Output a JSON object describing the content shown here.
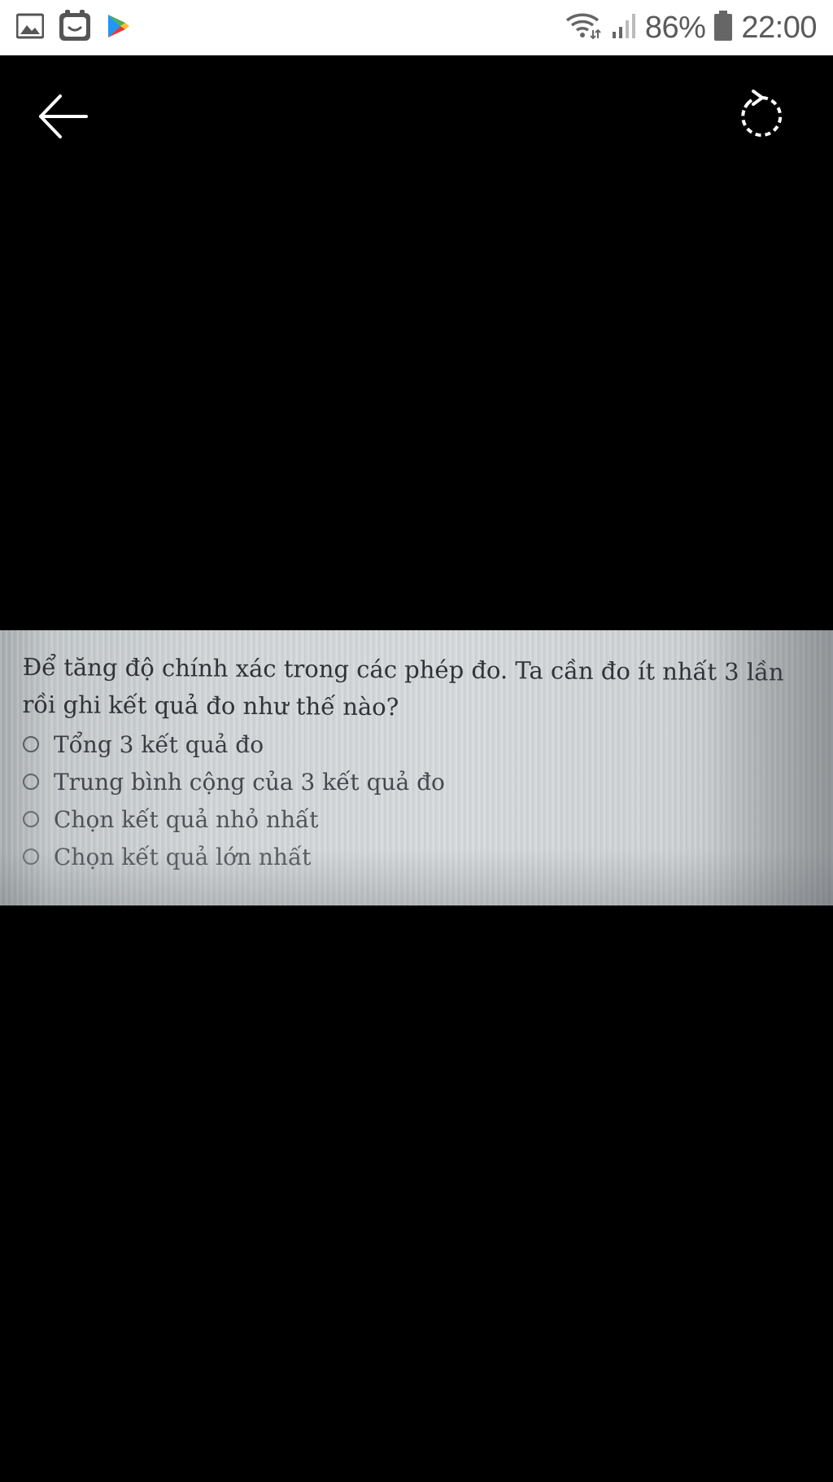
{
  "status_bar": {
    "left_icons": [
      "gallery-notification-icon",
      "face-app-notification-icon",
      "play-store-notification-icon"
    ],
    "right_icons": [
      "wifi-icon",
      "signal-icon",
      "battery-icon"
    ],
    "battery_percent": "86%",
    "time": "22:00"
  },
  "toolbar": {
    "back_icon": "back-arrow-icon",
    "rotate_icon": "rotate-icon"
  },
  "photo": {
    "question": "Để tăng độ chính xác trong các phép đo. Ta cần đo ít nhất 3 lần rồi ghi kết quả đo như thế nào?",
    "options": [
      "Tổng 3 kết quả đo",
      "Trung bình cộng của 3 kết quả đo",
      "Chọn kết quả nhỏ nhất",
      "Chọn kết quả lớn nhất"
    ]
  }
}
